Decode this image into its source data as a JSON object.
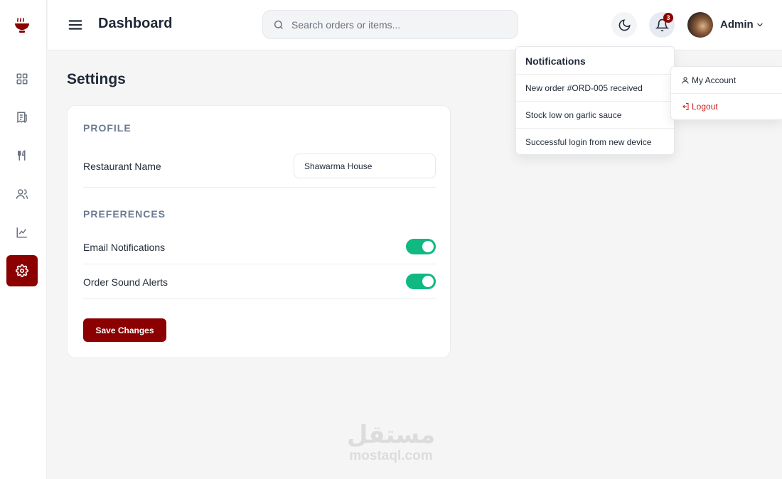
{
  "header": {
    "title": "Dashboard",
    "search_placeholder": "Search orders or items...",
    "notification_count": "3",
    "user_name": "Admin"
  },
  "sidebar": {
    "items": [
      {
        "name": "dashboard",
        "icon": "grid-icon"
      },
      {
        "name": "orders",
        "icon": "receipt-icon"
      },
      {
        "name": "menu",
        "icon": "utensils-icon"
      },
      {
        "name": "customers",
        "icon": "users-icon"
      },
      {
        "name": "analytics",
        "icon": "chart-line-icon"
      },
      {
        "name": "settings",
        "icon": "gear-icon",
        "active": true
      }
    ]
  },
  "settings": {
    "title": "Settings",
    "profile_heading": "PROFILE",
    "restaurant_name_label": "Restaurant Name",
    "restaurant_name_value": "Shawarma House",
    "preferences_heading": "PREFERENCES",
    "email_notifications_label": "Email Notifications",
    "email_notifications_on": true,
    "order_sound_label": "Order Sound Alerts",
    "order_sound_on": true,
    "save_label": "Save Changes"
  },
  "notifications": {
    "title": "Notifications",
    "items": [
      "New order #ORD-005 received",
      "Stock low on garlic sauce",
      "Successful login from new device"
    ]
  },
  "account_menu": {
    "my_account": "My Account",
    "logout": "Logout"
  },
  "watermark": {
    "arabic": "مستقل",
    "latin": "mostaql.com"
  },
  "colors": {
    "brand": "#8b0000",
    "toggle_on": "#10b981",
    "logout": "#c81e1e"
  }
}
